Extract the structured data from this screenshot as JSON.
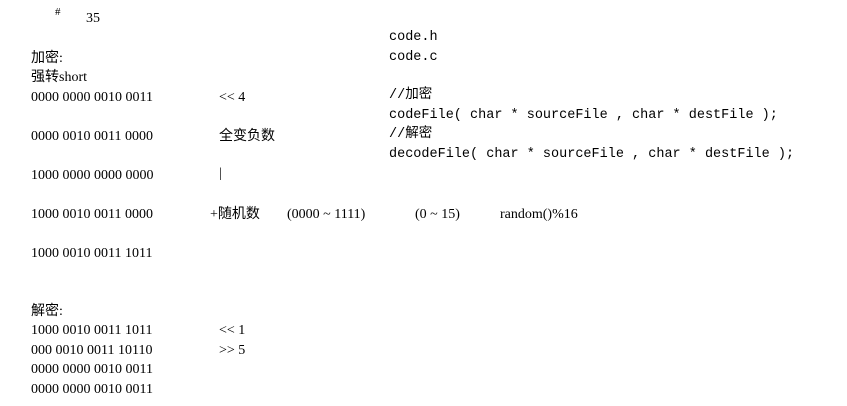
{
  "header": {
    "hash": "#",
    "number": "35"
  },
  "left": {
    "encrypt_heading": "加密:",
    "cast_short": "强转short",
    "row1_bits": "0000 0000 0010 0011",
    "row1_op": "<< 4",
    "row2_bits": "0000 0010 0011 0000",
    "row2_note": "全变负数",
    "row3_bits": "1000 0000 0000 0000",
    "row3_op": "|",
    "row4_bits": "1000 0010 0011 0000",
    "row4_op": "+随机数",
    "row4_range1": "(0000 ~ 1111)",
    "row4_range2": "(0 ~ 15)",
    "row4_expr": "random()%16",
    "row5_bits": "1000 0010 0011 1011",
    "decrypt_heading": "解密:",
    "drow1_bits": "1000 0010 0011 1011",
    "drow1_op": "<< 1",
    "drow2_bits": "000 0010 0011 10110",
    "drow2_op": ">> 5",
    "drow3_bits": "0000 0000 0010 0011",
    "drow4_bits": "0000 0000 0010 0011"
  },
  "right": {
    "file_h": "code.h",
    "file_c": "code.c",
    "comment_encrypt": "//加密",
    "code_encode": "codeFile( char * sourceFile , char * destFile );",
    "comment_decrypt": "//解密",
    "code_decode": "decodeFile( char * sourceFile , char * destFile );"
  }
}
